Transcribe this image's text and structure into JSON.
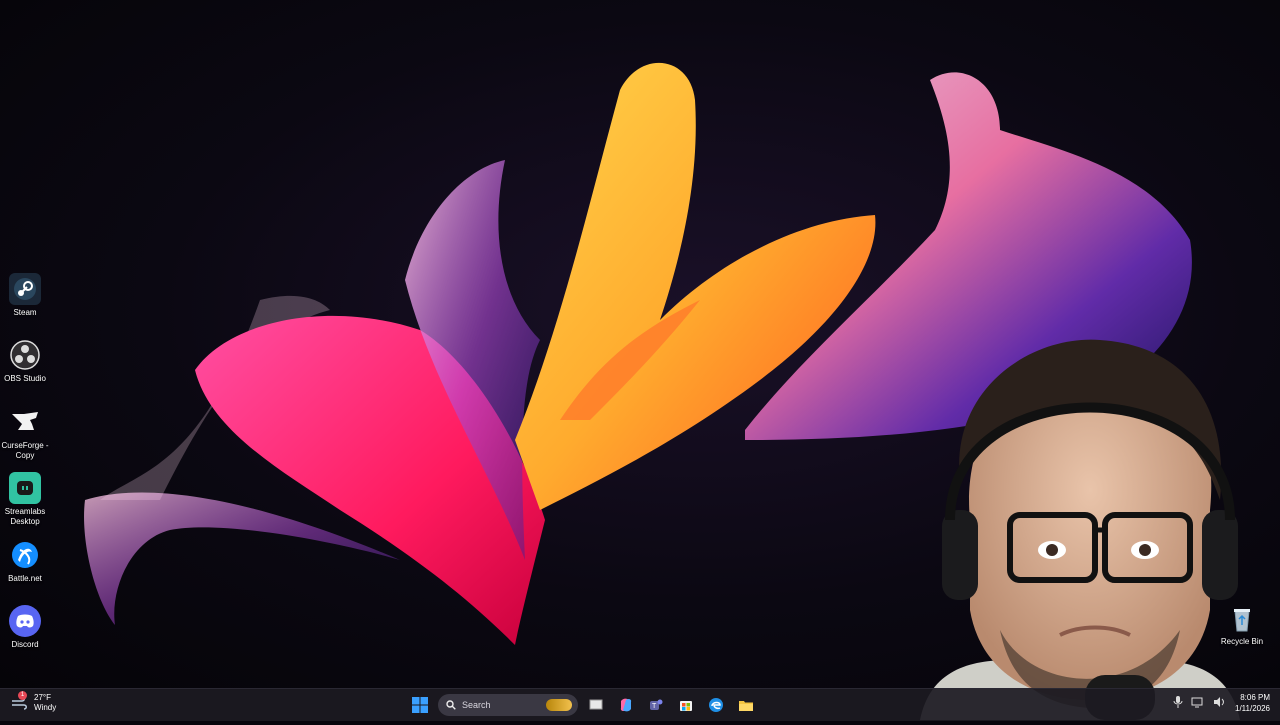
{
  "desktop_icons": [
    {
      "label": "Steam",
      "icon": "steam-icon",
      "color": "#1b2838"
    },
    {
      "label": "OBS Studio",
      "icon": "obs-icon",
      "color": "#302e31"
    },
    {
      "label": "CurseForge - Copy",
      "icon": "curseforge-icon",
      "color": "#111111"
    },
    {
      "label": "Streamlabs Desktop",
      "icon": "streamlabs-icon",
      "color": "#31c3a2"
    },
    {
      "label": "Battle.net",
      "icon": "battlenet-icon",
      "color": "#148eff"
    },
    {
      "label": "Discord",
      "icon": "discord-icon",
      "color": "#5865f2"
    }
  ],
  "recycle_bin": {
    "label": "Recycle Bin"
  },
  "taskbar": {
    "weather": {
      "temp": "27°F",
      "condition": "Windy",
      "alert": "1"
    },
    "search": {
      "placeholder": "Search"
    },
    "apps": [
      "start-icon",
      "file-explorer-icon",
      "copilot-icon",
      "teams-icon",
      "store-icon",
      "edge-icon",
      "folder-icon"
    ],
    "clock": {
      "time": "8:06 PM",
      "date": "1/11/2026"
    }
  },
  "colors": {
    "taskbar": "#1c1a22",
    "accent": "#0078d4",
    "pink": "#ff2d8a",
    "orange": "#ff8a1f"
  }
}
